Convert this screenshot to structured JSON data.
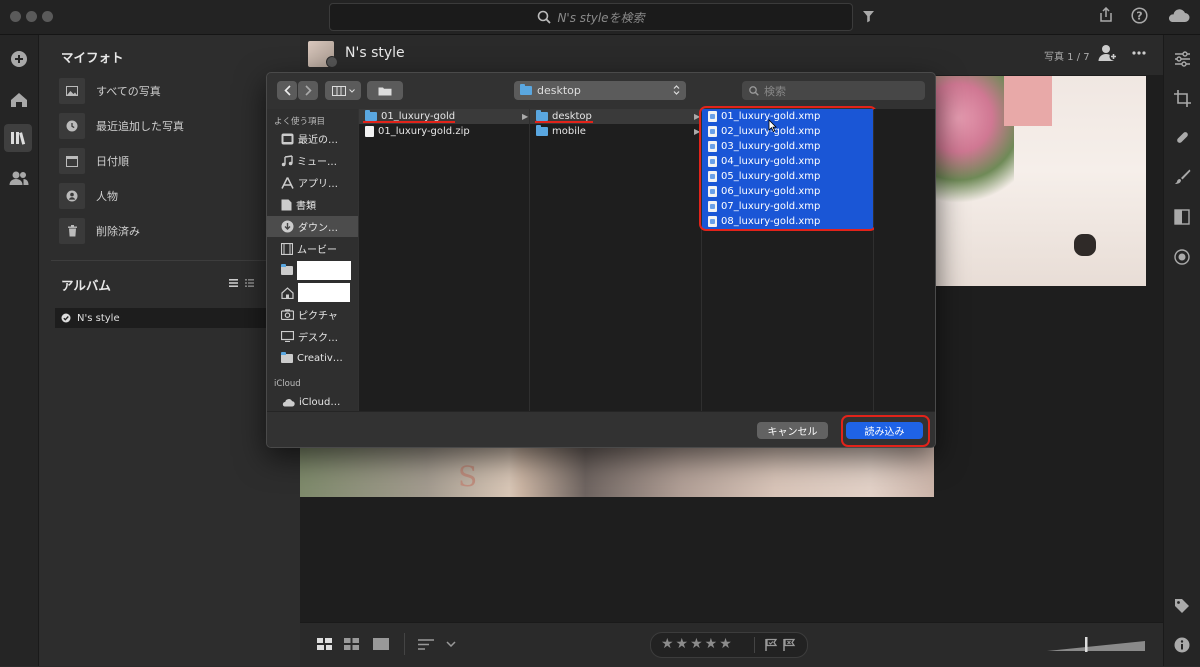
{
  "topbar": {
    "search_placeholder": "N's styleを検索"
  },
  "sidebar": {
    "my_photos_title": "マイフォト",
    "items": [
      {
        "label": "すべての写真",
        "icon": "photo-icon"
      },
      {
        "label": "最近追加した写真",
        "icon": "clock-icon"
      },
      {
        "label": "日付順",
        "icon": "calendar-icon"
      },
      {
        "label": "人物",
        "icon": "person-icon"
      },
      {
        "label": "削除済み",
        "icon": "trash-icon"
      }
    ],
    "albums_title": "アルバム",
    "album_item": "N's style"
  },
  "main": {
    "album_title": "N's style",
    "photo_count": "写真 1 / 7"
  },
  "dialog": {
    "location": "desktop",
    "search_placeholder": "検索",
    "favorites_header": "よく使う項目",
    "favorites": [
      {
        "label": "最近の…",
        "icon": "recent-icon"
      },
      {
        "label": "ミュー…",
        "icon": "music-icon"
      },
      {
        "label": "アプリ…",
        "icon": "apps-icon"
      },
      {
        "label": "書類",
        "icon": "documents-icon"
      },
      {
        "label": "ダウン…",
        "icon": "download-icon"
      },
      {
        "label": "ムービー",
        "icon": "movie-icon"
      },
      {
        "label": "",
        "icon": "folder-icon"
      },
      {
        "label": "",
        "icon": "home-icon"
      },
      {
        "label": "ピクチャ",
        "icon": "camera-icon"
      },
      {
        "label": "デスク…",
        "icon": "desktop-icon"
      },
      {
        "label": "Creativ…",
        "icon": "folder-icon"
      }
    ],
    "icloud_header": "iCloud",
    "icloud_item": "iCloud…",
    "column1": [
      "01_luxury-gold",
      "01_luxury-gold.zip"
    ],
    "column2": [
      "desktop",
      "mobile"
    ],
    "column3": [
      "01_luxury-gold.xmp",
      "02_luxury-gold.xmp",
      "03_luxury-gold.xmp",
      "04_luxury-gold.xmp",
      "05_luxury-gold.xmp",
      "06_luxury-gold.xmp",
      "07_luxury-gold.xmp",
      "08_luxury-gold.xmp"
    ],
    "cancel_label": "キャンセル",
    "import_label": "読み込み"
  },
  "bottombar": {
    "stars": "★★★★★"
  },
  "colors": {
    "accent": "#1a56d6",
    "annotation": "#e2231a"
  }
}
